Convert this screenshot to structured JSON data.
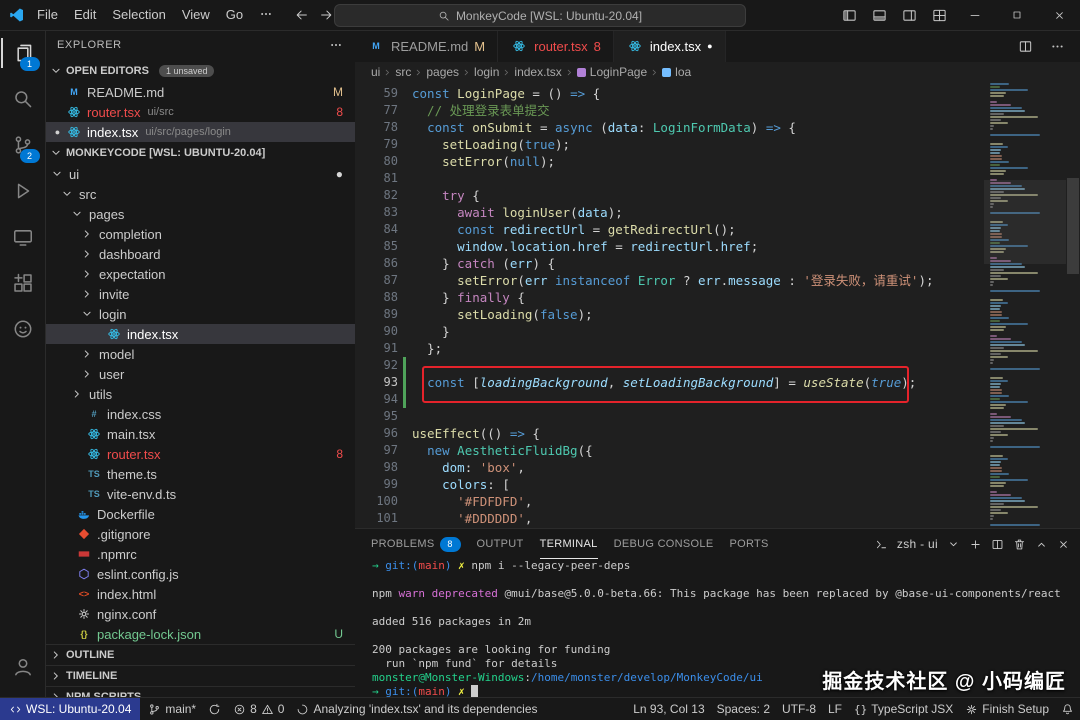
{
  "title_bar": {
    "menus": [
      "File",
      "Edit",
      "Selection",
      "View",
      "Go"
    ],
    "window_title": "MonkeyCode [WSL: Ubuntu-20.04]"
  },
  "activity_bar": {
    "items": [
      {
        "name": "explorer",
        "icon": "files",
        "active": true,
        "badge": "1"
      },
      {
        "name": "search",
        "icon": "search"
      },
      {
        "name": "source-control",
        "icon": "scm",
        "badge": "2"
      },
      {
        "name": "run-debug",
        "icon": "debug"
      },
      {
        "name": "remote-explorer",
        "icon": "remote"
      },
      {
        "name": "extensions",
        "icon": "extensions"
      },
      {
        "name": "monkeycode",
        "icon": "logo"
      }
    ],
    "bottom": [
      {
        "name": "account",
        "icon": "account"
      }
    ]
  },
  "explorer": {
    "title": "EXPLORER",
    "open_editors": {
      "label": "OPEN EDITORS",
      "badge": "1 unsaved",
      "items": [
        {
          "icon": "md",
          "name": "README.md",
          "decoration": "M",
          "dec_color": "#e2c08d"
        },
        {
          "icon": "react",
          "name": "router.tsx",
          "desc": "ui/src",
          "decoration": "8",
          "dec_color": "#f14c4c",
          "name_color": "#f14c4c"
        },
        {
          "icon": "react",
          "name": "index.tsx",
          "desc": "ui/src/pages/login",
          "dirty": true,
          "selected": true
        }
      ]
    },
    "section": "MONKEYCODE [WSL: UBUNTU-20.04]",
    "tree": [
      {
        "indent": 0,
        "chevron": "down",
        "label": "ui",
        "decoration": "●",
        "dec_color": "#d7d7d7"
      },
      {
        "indent": 1,
        "chevron": "down",
        "label": "src"
      },
      {
        "indent": 2,
        "chevron": "down",
        "label": "pages"
      },
      {
        "indent": 3,
        "chevron": "right",
        "label": "completion"
      },
      {
        "indent": 3,
        "chevron": "right",
        "label": "dashboard"
      },
      {
        "indent": 3,
        "chevron": "right",
        "label": "expectation"
      },
      {
        "indent": 3,
        "chevron": "right",
        "label": "invite"
      },
      {
        "indent": 3,
        "chevron": "down",
        "label": "login"
      },
      {
        "indent": 4,
        "icon": "react",
        "label": "index.tsx",
        "selected": true
      },
      {
        "indent": 3,
        "chevron": "right",
        "label": "model"
      },
      {
        "indent": 3,
        "chevron": "right",
        "label": "user"
      },
      {
        "indent": 2,
        "chevron": "right",
        "label": "utils"
      },
      {
        "indent": 2,
        "icon": "css",
        "label": "index.css"
      },
      {
        "indent": 2,
        "icon": "react",
        "label": "main.tsx"
      },
      {
        "indent": 2,
        "icon": "react",
        "label": "router.tsx",
        "decoration": "8",
        "dec_color": "#f14c4c",
        "color": "#f14c4c"
      },
      {
        "indent": 2,
        "icon": "ts",
        "label": "theme.ts"
      },
      {
        "indent": 2,
        "icon": "ts",
        "label": "vite-env.d.ts"
      },
      {
        "indent": 1,
        "icon": "docker",
        "label": "Dockerfile"
      },
      {
        "indent": 1,
        "icon": "git",
        "label": ".gitignore"
      },
      {
        "indent": 1,
        "icon": "npm",
        "label": ".npmrc"
      },
      {
        "indent": 1,
        "icon": "eslint",
        "label": "eslint.config.js"
      },
      {
        "indent": 1,
        "icon": "html",
        "label": "index.html"
      },
      {
        "indent": 1,
        "icon": "conf",
        "label": "nginx.conf"
      },
      {
        "indent": 1,
        "icon": "json",
        "label": "package-lock.json",
        "decoration": "U",
        "dec_color": "#73c991",
        "color": "#73c991"
      }
    ],
    "bottom_sections": [
      "OUTLINE",
      "TIMELINE",
      "NPM SCRIPTS"
    ]
  },
  "editor": {
    "tabs": [
      {
        "icon": "md",
        "label": "README.md",
        "decoration": "M",
        "dec_color": "#e2c08d"
      },
      {
        "icon": "react",
        "label": "router.tsx",
        "decoration": "8",
        "dec_color": "#f14c4c",
        "label_color": "#f14c4c"
      },
      {
        "icon": "react",
        "label": "index.tsx",
        "active": true,
        "dirty": true
      }
    ],
    "breadcrumb": [
      {
        "label": "ui"
      },
      {
        "label": "src"
      },
      {
        "label": "pages"
      },
      {
        "label": "login"
      },
      {
        "label": "index.tsx"
      },
      {
        "label": "LoginPage",
        "symbol": "#b180d7"
      },
      {
        "label": "loa",
        "symbol": "#75beff"
      }
    ],
    "code": {
      "lines": [
        {
          "n": 59,
          "t": [
            [
              "k",
              "const"
            ],
            [
              "p",
              " "
            ],
            [
              "f",
              "LoginPage"
            ],
            [
              "p",
              " = () "
            ],
            [
              "k",
              "=>"
            ],
            [
              "p",
              " {"
            ]
          ]
        },
        {
          "n": 77,
          "t": [
            [
              "m",
              "  // 处理登录表单提交"
            ]
          ]
        },
        {
          "n": 78,
          "t": [
            [
              "p",
              "  "
            ],
            [
              "k",
              "const"
            ],
            [
              "p",
              " "
            ],
            [
              "f",
              "onSubmit"
            ],
            [
              "p",
              " = "
            ],
            [
              "k",
              "async"
            ],
            [
              "p",
              " ("
            ],
            [
              "v",
              "data"
            ],
            [
              "p",
              ": "
            ],
            [
              "t",
              "LoginFormData"
            ],
            [
              "p",
              ") "
            ],
            [
              "k",
              "=>"
            ],
            [
              "p",
              " {"
            ]
          ]
        },
        {
          "n": 79,
          "t": [
            [
              "p",
              "    "
            ],
            [
              "f",
              "setLoading"
            ],
            [
              "p",
              "("
            ],
            [
              "k",
              "true"
            ],
            [
              "p",
              ");"
            ]
          ]
        },
        {
          "n": 80,
          "t": [
            [
              "p",
              "    "
            ],
            [
              "f",
              "setError"
            ],
            [
              "p",
              "("
            ],
            [
              "k",
              "null"
            ],
            [
              "p",
              ");"
            ]
          ]
        },
        {
          "n": 81,
          "t": []
        },
        {
          "n": 82,
          "t": [
            [
              "p",
              "    "
            ],
            [
              "c",
              "try"
            ],
            [
              "p",
              " {"
            ]
          ]
        },
        {
          "n": 83,
          "t": [
            [
              "p",
              "      "
            ],
            [
              "c",
              "await"
            ],
            [
              "p",
              " "
            ],
            [
              "f",
              "loginUser"
            ],
            [
              "p",
              "("
            ],
            [
              "v",
              "data"
            ],
            [
              "p",
              ");"
            ]
          ]
        },
        {
          "n": 84,
          "t": [
            [
              "p",
              "      "
            ],
            [
              "k",
              "const"
            ],
            [
              "p",
              " "
            ],
            [
              "v",
              "redirectUrl"
            ],
            [
              "p",
              " = "
            ],
            [
              "f",
              "getRedirectUrl"
            ],
            [
              "p",
              "();"
            ]
          ]
        },
        {
          "n": 85,
          "t": [
            [
              "p",
              "      "
            ],
            [
              "v",
              "window"
            ],
            [
              "p",
              "."
            ],
            [
              "v",
              "location"
            ],
            [
              "p",
              "."
            ],
            [
              "v",
              "href"
            ],
            [
              "p",
              " = "
            ],
            [
              "v",
              "redirectUrl"
            ],
            [
              "p",
              "."
            ],
            [
              "v",
              "href"
            ],
            [
              "p",
              ";"
            ]
          ]
        },
        {
          "n": 86,
          "t": [
            [
              "p",
              "    } "
            ],
            [
              "c",
              "catch"
            ],
            [
              "p",
              " ("
            ],
            [
              "v",
              "err"
            ],
            [
              "p",
              ") {"
            ]
          ]
        },
        {
          "n": 87,
          "t": [
            [
              "p",
              "      "
            ],
            [
              "f",
              "setError"
            ],
            [
              "p",
              "("
            ],
            [
              "v",
              "err"
            ],
            [
              "p",
              " "
            ],
            [
              "k",
              "instanceof"
            ],
            [
              "p",
              " "
            ],
            [
              "t",
              "Error"
            ],
            [
              "p",
              " ? "
            ],
            [
              "v",
              "err"
            ],
            [
              "p",
              "."
            ],
            [
              "v",
              "message"
            ],
            [
              "p",
              " : "
            ],
            [
              "s",
              "'登录失败，请重试'"
            ],
            [
              "p",
              ");"
            ]
          ]
        },
        {
          "n": 88,
          "t": [
            [
              "p",
              "    } "
            ],
            [
              "c",
              "finally"
            ],
            [
              "p",
              " {"
            ]
          ]
        },
        {
          "n": 89,
          "t": [
            [
              "p",
              "      "
            ],
            [
              "f",
              "setLoading"
            ],
            [
              "p",
              "("
            ],
            [
              "k",
              "false"
            ],
            [
              "p",
              ");"
            ]
          ]
        },
        {
          "n": 90,
          "t": [
            [
              "p",
              "    }"
            ]
          ]
        },
        {
          "n": 91,
          "t": [
            [
              "p",
              "  };"
            ]
          ]
        },
        {
          "n": 92,
          "t": [],
          "chg": true
        },
        {
          "n": 93,
          "t": [
            [
              "p",
              "  "
            ],
            [
              "k",
              "const"
            ],
            [
              "p",
              " ["
            ],
            [
              "v i",
              "loadingBackground"
            ],
            [
              "p",
              ", "
            ],
            [
              "v i",
              "setLoadingBackground"
            ],
            [
              "p",
              "] = "
            ],
            [
              "f i",
              "useState"
            ],
            [
              "p",
              "("
            ],
            [
              "k i",
              "true"
            ],
            [
              "p",
              ");"
            ]
          ],
          "chg": true,
          "box": true
        },
        {
          "n": 94,
          "t": [],
          "chg": true
        },
        {
          "n": 95,
          "t": []
        },
        {
          "n": 96,
          "t": [
            [
              "f",
              "useEffect"
            ],
            [
              "p",
              "(() "
            ],
            [
              "k",
              "=>"
            ],
            [
              "p",
              " {"
            ]
          ]
        },
        {
          "n": 97,
          "t": [
            [
              "p",
              "  "
            ],
            [
              "k",
              "new"
            ],
            [
              "p",
              " "
            ],
            [
              "t",
              "AestheticFluidBg"
            ],
            [
              "p",
              "({"
            ]
          ]
        },
        {
          "n": 98,
          "t": [
            [
              "p",
              "    "
            ],
            [
              "v",
              "dom"
            ],
            [
              "p",
              ": "
            ],
            [
              "s",
              "'box'"
            ],
            [
              "p",
              ","
            ]
          ]
        },
        {
          "n": 99,
          "t": [
            [
              "p",
              "    "
            ],
            [
              "v",
              "colors"
            ],
            [
              "p",
              ": ["
            ]
          ]
        },
        {
          "n": 100,
          "t": [
            [
              "p",
              "      "
            ],
            [
              "s",
              "'#FDFDFD'"
            ],
            [
              "p",
              ","
            ]
          ]
        },
        {
          "n": 101,
          "t": [
            [
              "p",
              "      "
            ],
            [
              "s",
              "'#DDDDDD'"
            ],
            [
              "p",
              ","
            ]
          ]
        }
      ]
    }
  },
  "panel": {
    "tabs": [
      {
        "label": "PROBLEMS",
        "badge": "8"
      },
      {
        "label": "OUTPUT"
      },
      {
        "label": "TERMINAL",
        "active": true
      },
      {
        "label": "DEBUG CONSOLE"
      },
      {
        "label": "PORTS"
      }
    ],
    "shell_label": "zsh - ui",
    "terminal": [
      [
        [
          "tg",
          "→ "
        ],
        [
          "tb",
          "git:("
        ],
        [
          "tr",
          "main"
        ],
        [
          "tb",
          ")"
        ],
        [
          "ty",
          " ✗ "
        ],
        [
          "tw",
          "npm i --legacy-peer-deps"
        ]
      ],
      [],
      [
        [
          "tw",
          "npm "
        ],
        [
          "tm",
          "warn"
        ],
        [
          "tw",
          " "
        ],
        [
          "tm",
          "deprecated"
        ],
        [
          "tw",
          " @mui/base@5.0.0-beta.66: This package has been replaced by @base-ui-components/react"
        ]
      ],
      [],
      [
        [
          "tw",
          "added 516 packages in 2m"
        ]
      ],
      [],
      [
        [
          "tw",
          "200 packages are looking for funding"
        ]
      ],
      [
        [
          "tw",
          "  run `npm fund` for details"
        ]
      ],
      [
        [
          "tg",
          "monster@Monster-Windows"
        ],
        [
          "tw",
          ":"
        ],
        [
          "tb",
          "/home/monster/develop/MonkeyCode/ui"
        ]
      ],
      [
        [
          "tg",
          "→ "
        ],
        [
          "tb",
          "git:("
        ],
        [
          "tr",
          "main"
        ],
        [
          "tb",
          ")"
        ],
        [
          "ty",
          " ✗ "
        ],
        [
          "cursor",
          ""
        ]
      ]
    ]
  },
  "status_bar": {
    "remote": "WSL: Ubuntu-20.04",
    "branch": "main*",
    "errors": "8",
    "warnings": "0",
    "message": "Analyzing 'index.tsx' and its dependencies",
    "right": [
      {
        "name": "cursor-position",
        "label": "Ln 93, Col 13"
      },
      {
        "name": "indentation",
        "label": "Spaces: 2"
      },
      {
        "name": "encoding",
        "label": "UTF-8"
      },
      {
        "name": "eol",
        "label": "LF"
      },
      {
        "name": "language-mode",
        "icon": "braces",
        "label": "TypeScript JSX"
      },
      {
        "name": "finish-setup",
        "icon": "conf",
        "label": "Finish Setup"
      },
      {
        "name": "notifications",
        "icon": "bell",
        "label": ""
      }
    ]
  },
  "watermark": "掘金技术社区 @ 小码编匠",
  "colors": {
    "accent": "#0078d4",
    "remote_bg": "#2b3a8f",
    "error": "#f14c4c",
    "modified": "#e2c08d",
    "untracked": "#73c991",
    "annotation": "#e5232b"
  }
}
